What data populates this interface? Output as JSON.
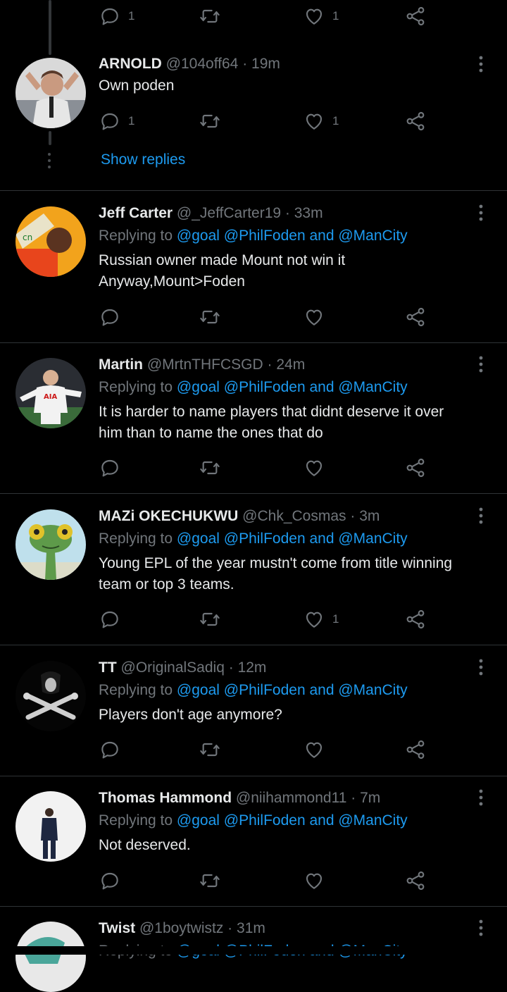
{
  "colors": {
    "background": "#000000",
    "link": "#1d9bf0",
    "muted": "#71767b",
    "text": "#e7e9ea",
    "divider": "#2f3336"
  },
  "top_actions": {
    "reply_count": "1",
    "like_count": "1"
  },
  "arnold": {
    "name": "ARNOLD",
    "handle": "@104off64",
    "time": "19m",
    "text": "Own poden",
    "reply_count": "1",
    "like_count": "1",
    "show_replies": "Show replies"
  },
  "replying_prefix": "Replying to",
  "replying_links": "@goal @PhilFoden and @ManCity",
  "tweets": [
    {
      "name": "Jeff Carter",
      "handle": "@_JeffCarter19",
      "time": "33m",
      "lines": [
        "Russian owner made Mount not win it",
        "Anyway,Mount>Foden"
      ],
      "like_count": ""
    },
    {
      "name": "Martin",
      "handle": "@MrtnTHFCSGD",
      "time": "24m",
      "lines": [
        "It is harder to name players that didnt deserve it over",
        "him than to name the ones that do"
      ],
      "like_count": ""
    },
    {
      "name": "MAZi OKECHUKWU",
      "handle": "@Chk_Cosmas",
      "time": "3m",
      "lines": [
        "Young EPL of the year mustn't come from title winning",
        "team or top 3 teams."
      ],
      "like_count": "1"
    },
    {
      "name": "TT",
      "handle": "@OriginalSadiq",
      "time": "12m",
      "lines": [
        "Players don't age anymore?"
      ],
      "like_count": ""
    },
    {
      "name": "Thomas Hammond",
      "handle": "@niihammond11",
      "time": "7m",
      "lines": [
        "Not deserved."
      ],
      "like_count": ""
    },
    {
      "name": "Twist",
      "handle": "@1boytwistz",
      "time": "31m",
      "lines": [],
      "like_count": ""
    }
  ],
  "icons": [
    "reply-icon",
    "retweet-icon",
    "like-icon",
    "share-icon",
    "more-icon"
  ]
}
